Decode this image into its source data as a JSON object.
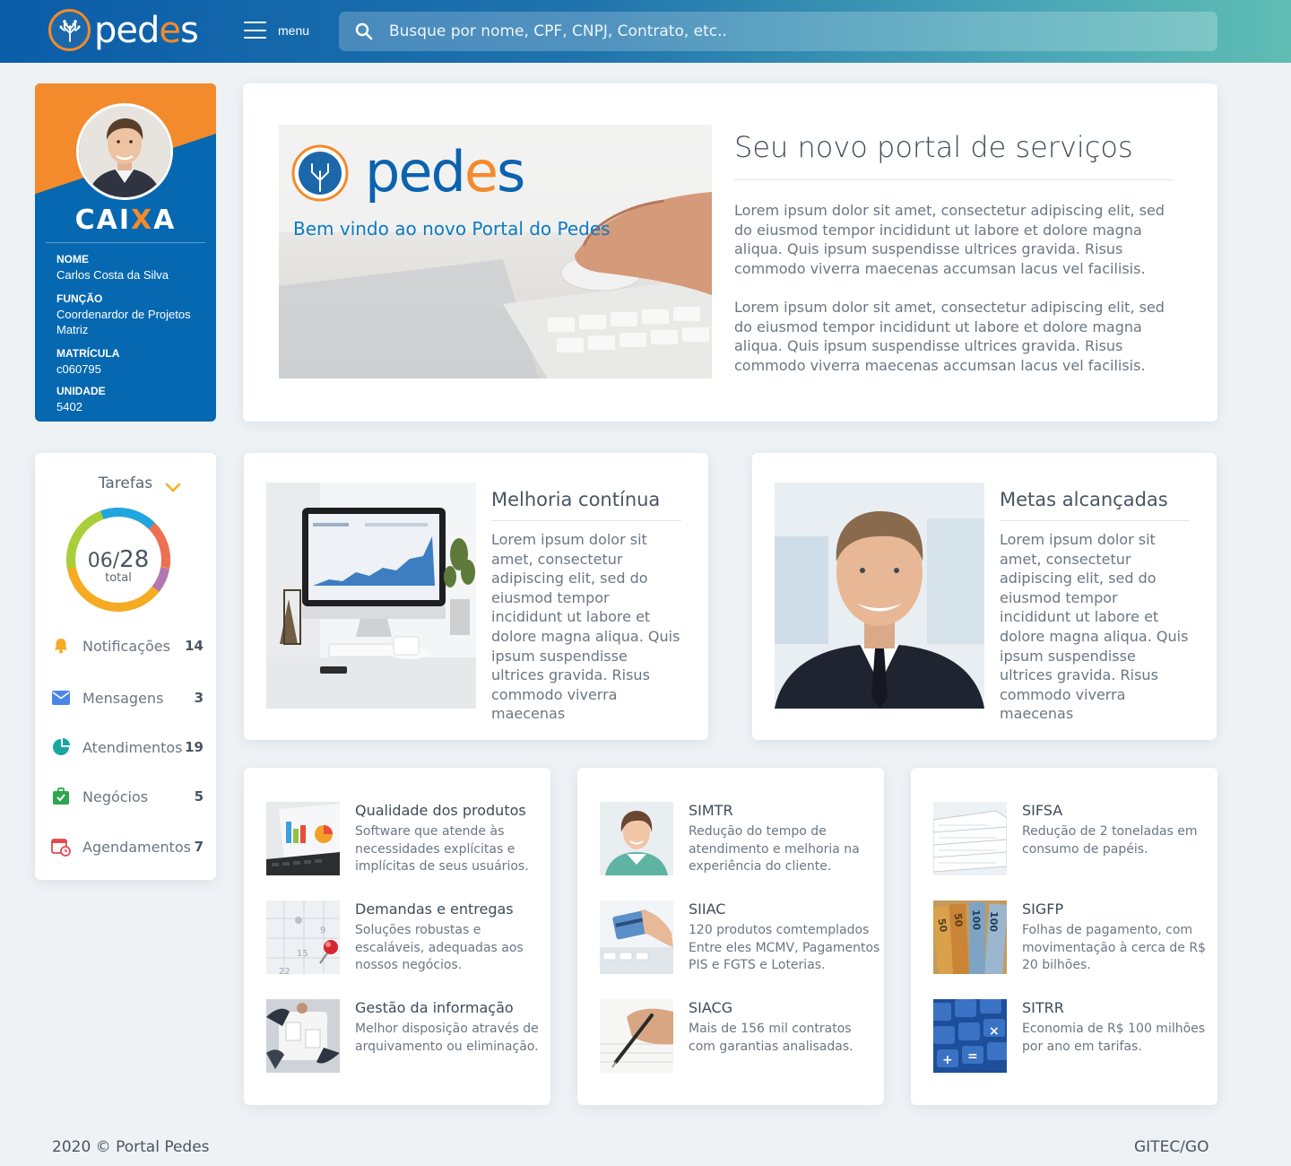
{
  "header": {
    "logo_text_prefix": "ped",
    "logo_text_o": "e",
    "logo_text_suffix": "s",
    "menu_label": "menu",
    "search_placeholder": "Busque por nome, CPF, CNPJ, Contrato, etc.."
  },
  "colors": {
    "brand_blue": "#0668b0",
    "brand_orange": "#f38a2c",
    "donut": [
      "#f6ab23",
      "#a8cf3a",
      "#21a5de",
      "#ee6f54",
      "#b277b3"
    ]
  },
  "profile": {
    "company_prefix": "CAI",
    "company_x": "X",
    "company_suffix": "A",
    "name_label": "NOME",
    "name": "Carlos Costa da Silva",
    "role_label": "FUNÇÃO",
    "role": "Coordenardor de Projetos Matriz",
    "id_label": "MATRÍCULA",
    "id": "c060795",
    "unit_label": "UNIDADE",
    "unit": "5402"
  },
  "tasks": {
    "title": "Tarefas",
    "done": "06",
    "total": "28",
    "total_label": "total",
    "items": [
      {
        "label": "Notificações",
        "count": "14",
        "icon": "bell-icon"
      },
      {
        "label": "Mensagens",
        "count": "3",
        "icon": "mail-icon"
      },
      {
        "label": "Atendimentos",
        "count": "19",
        "icon": "pie-chart-icon"
      },
      {
        "label": "Negócios",
        "count": "5",
        "icon": "briefcase-icon"
      },
      {
        "label": "Agendamentos",
        "count": "7",
        "icon": "calendar-icon"
      }
    ]
  },
  "hero": {
    "banner_logo_prefix": "ped",
    "banner_logo_o": "e",
    "banner_logo_suffix": "s",
    "banner_subtitle": "Bem vindo ao novo Portal do Pedes",
    "title": "Seu novo portal de serviços",
    "paragraph1": "Lorem ipsum dolor sit amet, consectetur adipiscing elit, sed do eiusmod tempor incididunt ut labore et dolore magna aliqua. Quis ipsum suspendisse ultrices gravida. Risus commodo viverra maecenas accumsan lacus vel facilisis.",
    "paragraph2": "Lorem ipsum dolor sit amet, consectetur adipiscing elit, sed do eiusmod tempor incididunt ut labore et dolore magna aliqua. Quis ipsum suspendisse ultrices gravida. Risus commodo viverra maecenas accumsan lacus vel facilisis."
  },
  "features": [
    {
      "title": "Melhoria contínua",
      "text": "Lorem ipsum dolor sit amet, consectetur adipiscing elit, sed do eiusmod tempor incididunt ut labore et dolore magna aliqua. Quis ipsum suspendisse ultrices gravida. Risus commodo viverra maecenas"
    },
    {
      "title": "Metas alcançadas",
      "text": "Lorem ipsum dolor sit amet, consectetur adipiscing elit, sed do eiusmod tempor incididunt ut labore et dolore magna aliqua. Quis ipsum suspendisse ultrices gravida. Risus commodo viverra maecenas"
    }
  ],
  "columns": [
    [
      {
        "title": "Qualidade dos produtos",
        "desc": "Software que atende às necessidades explícitas e implícitas de seus usuários."
      },
      {
        "title": "Demandas e entregas",
        "desc": "Soluções robustas e escaláveis, adequadas aos nossos negócios."
      },
      {
        "title": "Gestão da informação",
        "desc": "Melhor disposição através de arquivamento ou eliminação."
      }
    ],
    [
      {
        "title": "SIMTR",
        "desc": "Redução do tempo de atendimento e melhoria na experiência do cliente."
      },
      {
        "title": "SIIAC",
        "desc": "120 produtos comtemplados Entre eles MCMV, Pagamentos PIS e FGTS e Loterias."
      },
      {
        "title": "SIACG",
        "desc": "Mais de 156 mil contratos com garantias analisadas."
      }
    ],
    [
      {
        "title": "SIFSA",
        "desc": "Redução de 2 toneladas em consumo de papéis."
      },
      {
        "title": "SIGFP",
        "desc": "Folhas de pagamento, com movimentação à cerca de R$ 20 bilhões."
      },
      {
        "title": "SITRR",
        "desc": "Economia de R$ 100 milhões por ano em tarifas."
      }
    ]
  ],
  "footer": {
    "left": "2020 © Portal Pedes",
    "right": "GITEC/GO"
  }
}
